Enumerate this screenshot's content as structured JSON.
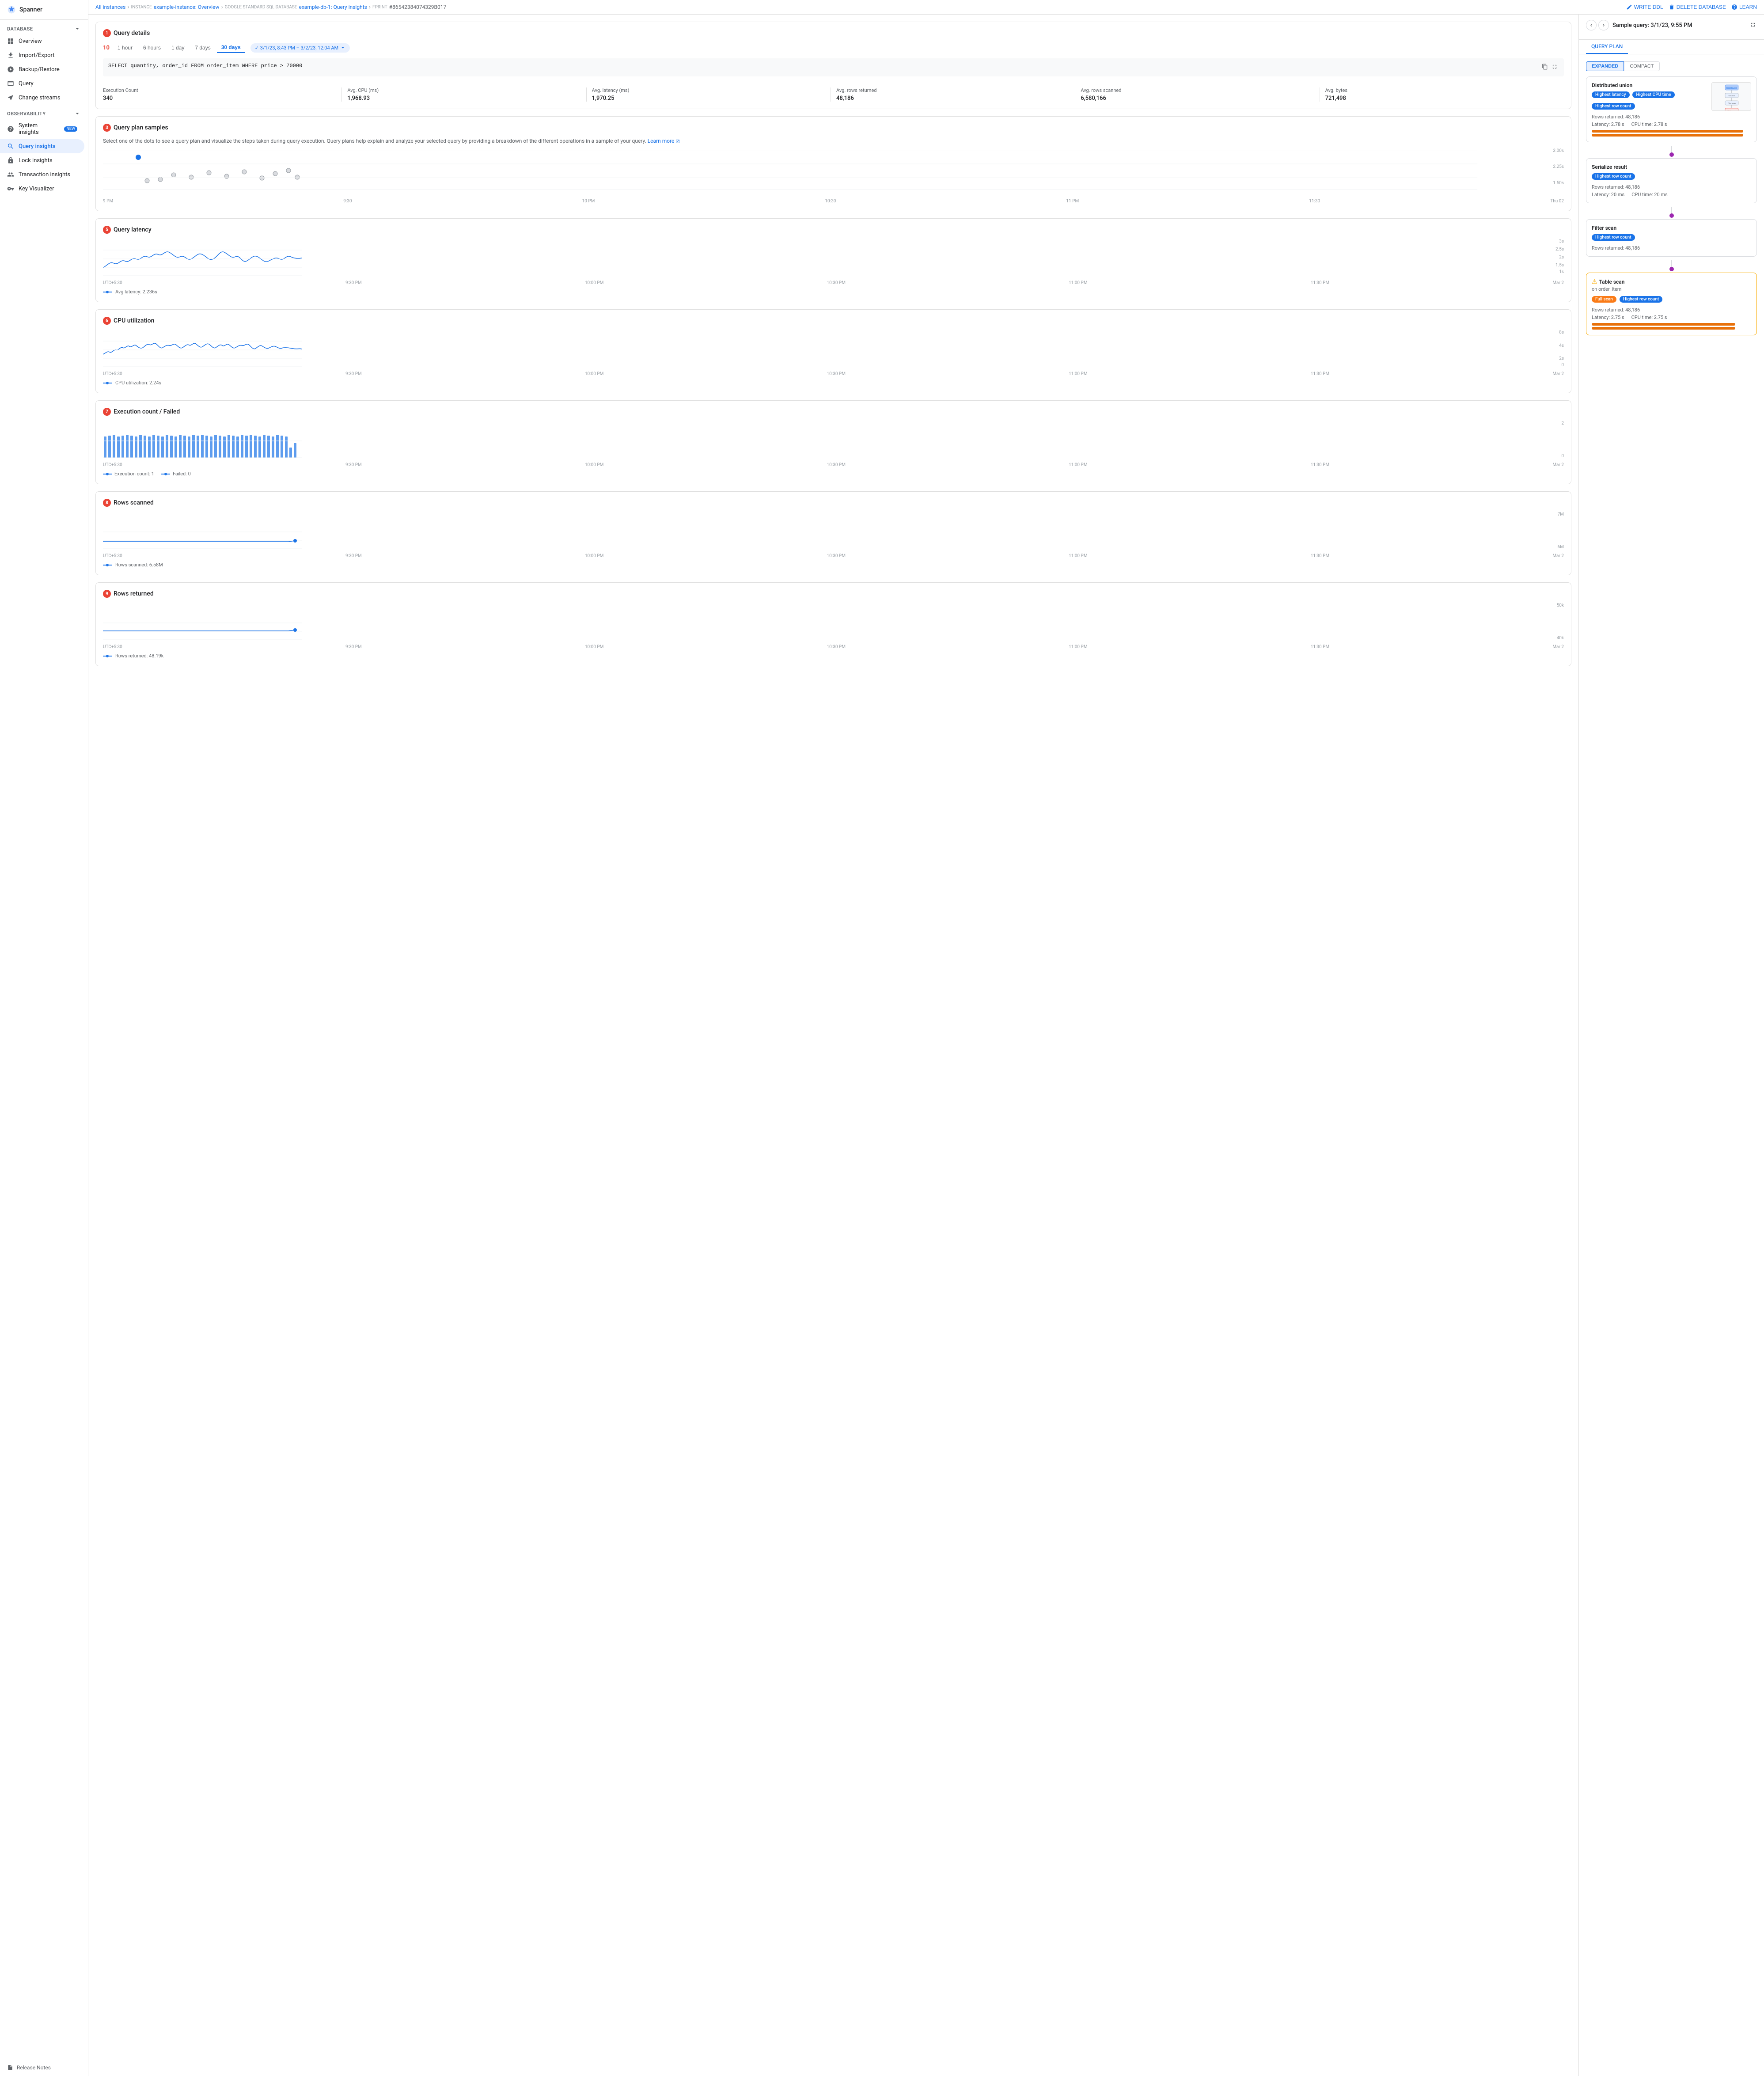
{
  "app": {
    "name": "Spanner"
  },
  "sidebar": {
    "database_section": "DATABASE",
    "observability_section": "OBSERVABILITY",
    "items": [
      {
        "id": "overview",
        "label": "Overview",
        "icon": "grid-icon"
      },
      {
        "id": "import-export",
        "label": "Import/Export",
        "icon": "import-icon"
      },
      {
        "id": "backup-restore",
        "label": "Backup/Restore",
        "icon": "backup-icon"
      },
      {
        "id": "query",
        "label": "Query",
        "icon": "query-icon"
      },
      {
        "id": "change-streams",
        "label": "Change streams",
        "icon": "streams-icon"
      },
      {
        "id": "system-insights",
        "label": "System insights",
        "icon": "insights-icon",
        "badge": "NEW"
      },
      {
        "id": "query-insights",
        "label": "Query insights",
        "icon": "query-insights-icon",
        "active": true
      },
      {
        "id": "lock-insights",
        "label": "Lock insights",
        "icon": "lock-icon"
      },
      {
        "id": "transaction-insights",
        "label": "Transaction insights",
        "icon": "transaction-icon"
      },
      {
        "id": "key-visualizer",
        "label": "Key Visualizer",
        "icon": "key-icon"
      }
    ],
    "release_notes": "Release Notes"
  },
  "breadcrumb": {
    "all_instances": "All instances",
    "instance_label": "INSTANCE",
    "instance_name": "example-instance: Overview",
    "db_label": "GOOGLE STANDARD SQL DATABASE",
    "db_name": "example-db-1: Query insights",
    "fprint_label": "FPRINT",
    "fprint_value": "#86542384074329B017"
  },
  "topbar_actions": {
    "write_ddl": "WRITE DDL",
    "delete_db": "DELETE DATABASE",
    "learn": "LEARN"
  },
  "query_details": {
    "section_number": "1",
    "title": "Query details",
    "time_buttons": [
      "1 hour",
      "6 hours",
      "1 day",
      "7 days",
      "30 days"
    ],
    "active_time": "1 hour",
    "date_range": "✓ 3/1/23, 8:43 PM – 3/2/23, 12:04 AM",
    "sql": "SELECT quantity, order_id FROM order_item WHERE price > 70000",
    "stats": [
      {
        "label": "Execution Count",
        "value": "340"
      },
      {
        "label": "Avg. CPU (ms)",
        "value": "1,968.93"
      },
      {
        "label": "Avg. latency (ms)",
        "value": "1,970.25"
      },
      {
        "label": "Avg. rows returned",
        "value": "48,186"
      },
      {
        "label": "Avg. rows scanned",
        "value": "6,580,166"
      },
      {
        "label": "Avg. bytes",
        "value": "721,498"
      }
    ]
  },
  "query_plan_samples": {
    "section_number": "3",
    "title": "Query plan samples",
    "description": "Select one of the dots to see a query plan and visualize the steps taken during query execution. Query plans help explain and analyze your selected query by providing a breakdown of the different operations in a sample of your query.",
    "learn_more": "Learn more",
    "y_max": "3.00s",
    "y_mid": "2.25s",
    "y_low": "1.50s",
    "x_labels": [
      "9 PM",
      "9:30",
      "10 PM",
      "10:30",
      "11 PM",
      "11:30",
      "Thu 02"
    ]
  },
  "query_latency": {
    "section_number": "5",
    "title": "Query latency",
    "y_max": "3s",
    "y_mid_upper": "2.5s",
    "y_mid": "2s",
    "y_mid_lower": "1.5s",
    "y_min": "1s",
    "x_labels": [
      "UTC+5:30",
      "9:30 PM",
      "10:00 PM",
      "10:30 PM",
      "11:00 PM",
      "11:30 PM",
      "Mar 2"
    ],
    "legend": "Avg latency: 2.236s"
  },
  "cpu_utilization": {
    "section_number": "6",
    "title": "CPU utilization",
    "y_max": "8s",
    "y_mid_upper": "4s",
    "y_mid": "2s",
    "y_min": "0",
    "x_labels": [
      "UTC+5:30",
      "9:30 PM",
      "10:00 PM",
      "10:30 PM",
      "11:00 PM",
      "11:30 PM",
      "Mar 2"
    ],
    "legend": "CPU utilization: 2.24s"
  },
  "execution_count": {
    "section_number": "7",
    "title": "Execution count / Failed",
    "y_max": "2",
    "y_min": "0",
    "x_labels": [
      "UTC+5:30",
      "9:30 PM",
      "10:00 PM",
      "10:30 PM",
      "11:00 PM",
      "11:30 PM",
      "Mar 2"
    ],
    "legend_execution": "Execution count: 1",
    "legend_failed": "Failed: 0"
  },
  "rows_scanned": {
    "section_number": "8",
    "title": "Rows scanned",
    "y_max": "7M",
    "y_min": "6M",
    "x_labels": [
      "UTC+5:30",
      "9:30 PM",
      "10:00 PM",
      "10:30 PM",
      "11:00 PM",
      "11:30 PM",
      "Mar 2"
    ],
    "legend": "Rows scanned: 6.58M"
  },
  "rows_returned": {
    "section_number": "9",
    "title": "Rows returned",
    "y_max": "50k",
    "y_min": "40k",
    "x_labels": [
      "UTC+5:30",
      "9:30 PM",
      "10:00 PM",
      "10:30 PM",
      "11:00 PM",
      "11:30 PM",
      "Mar 2"
    ],
    "legend": "Rows returned: 48.19k"
  },
  "right_panel": {
    "sample_query_title": "Sample query: 3/1/23, 9:55 PM",
    "tabs": [
      {
        "id": "query-plan",
        "label": "QUERY PLAN",
        "active": true
      }
    ],
    "toggle_expanded": "EXPANDED",
    "toggle_compact": "COMPACT",
    "nodes": [
      {
        "id": "distributed-union",
        "title": "Distributed union",
        "badges": [
          "Highest latency",
          "Highest CPU time",
          "Highest row count"
        ],
        "badge_types": [
          "blue",
          "blue",
          "blue"
        ],
        "rows_returned": "48,186",
        "latency": "Latency: 2.78 s",
        "cpu_time": "CPU time: 2.78 s",
        "has_bar": true,
        "bar_latency_pct": 95,
        "bar_cpu_pct": 95
      },
      {
        "id": "serialize-result",
        "title": "Serialize result",
        "badges": [
          "Highest row count"
        ],
        "badge_types": [
          "blue"
        ],
        "rows_returned": "48,186",
        "latency": "Latency: 20 ms",
        "cpu_time": "CPU time: 20 ms",
        "has_bar": false
      },
      {
        "id": "filter-scan",
        "title": "Filter scan",
        "badges": [
          "Highest row count"
        ],
        "badge_types": [
          "blue"
        ],
        "rows_returned": "48,186",
        "has_bar": false
      },
      {
        "id": "table-scan",
        "title": "Table scan",
        "subtitle": "on order_item",
        "warning": true,
        "badges": [
          "Full scan",
          "Highest row count"
        ],
        "badge_types": [
          "orange",
          "blue"
        ],
        "rows_returned": "48,186",
        "latency": "Latency: 2.75 s",
        "cpu_time": "CPU time: 2.75 s",
        "has_bar": true,
        "bar_latency_pct": 90,
        "bar_cpu_pct": 90
      }
    ]
  }
}
